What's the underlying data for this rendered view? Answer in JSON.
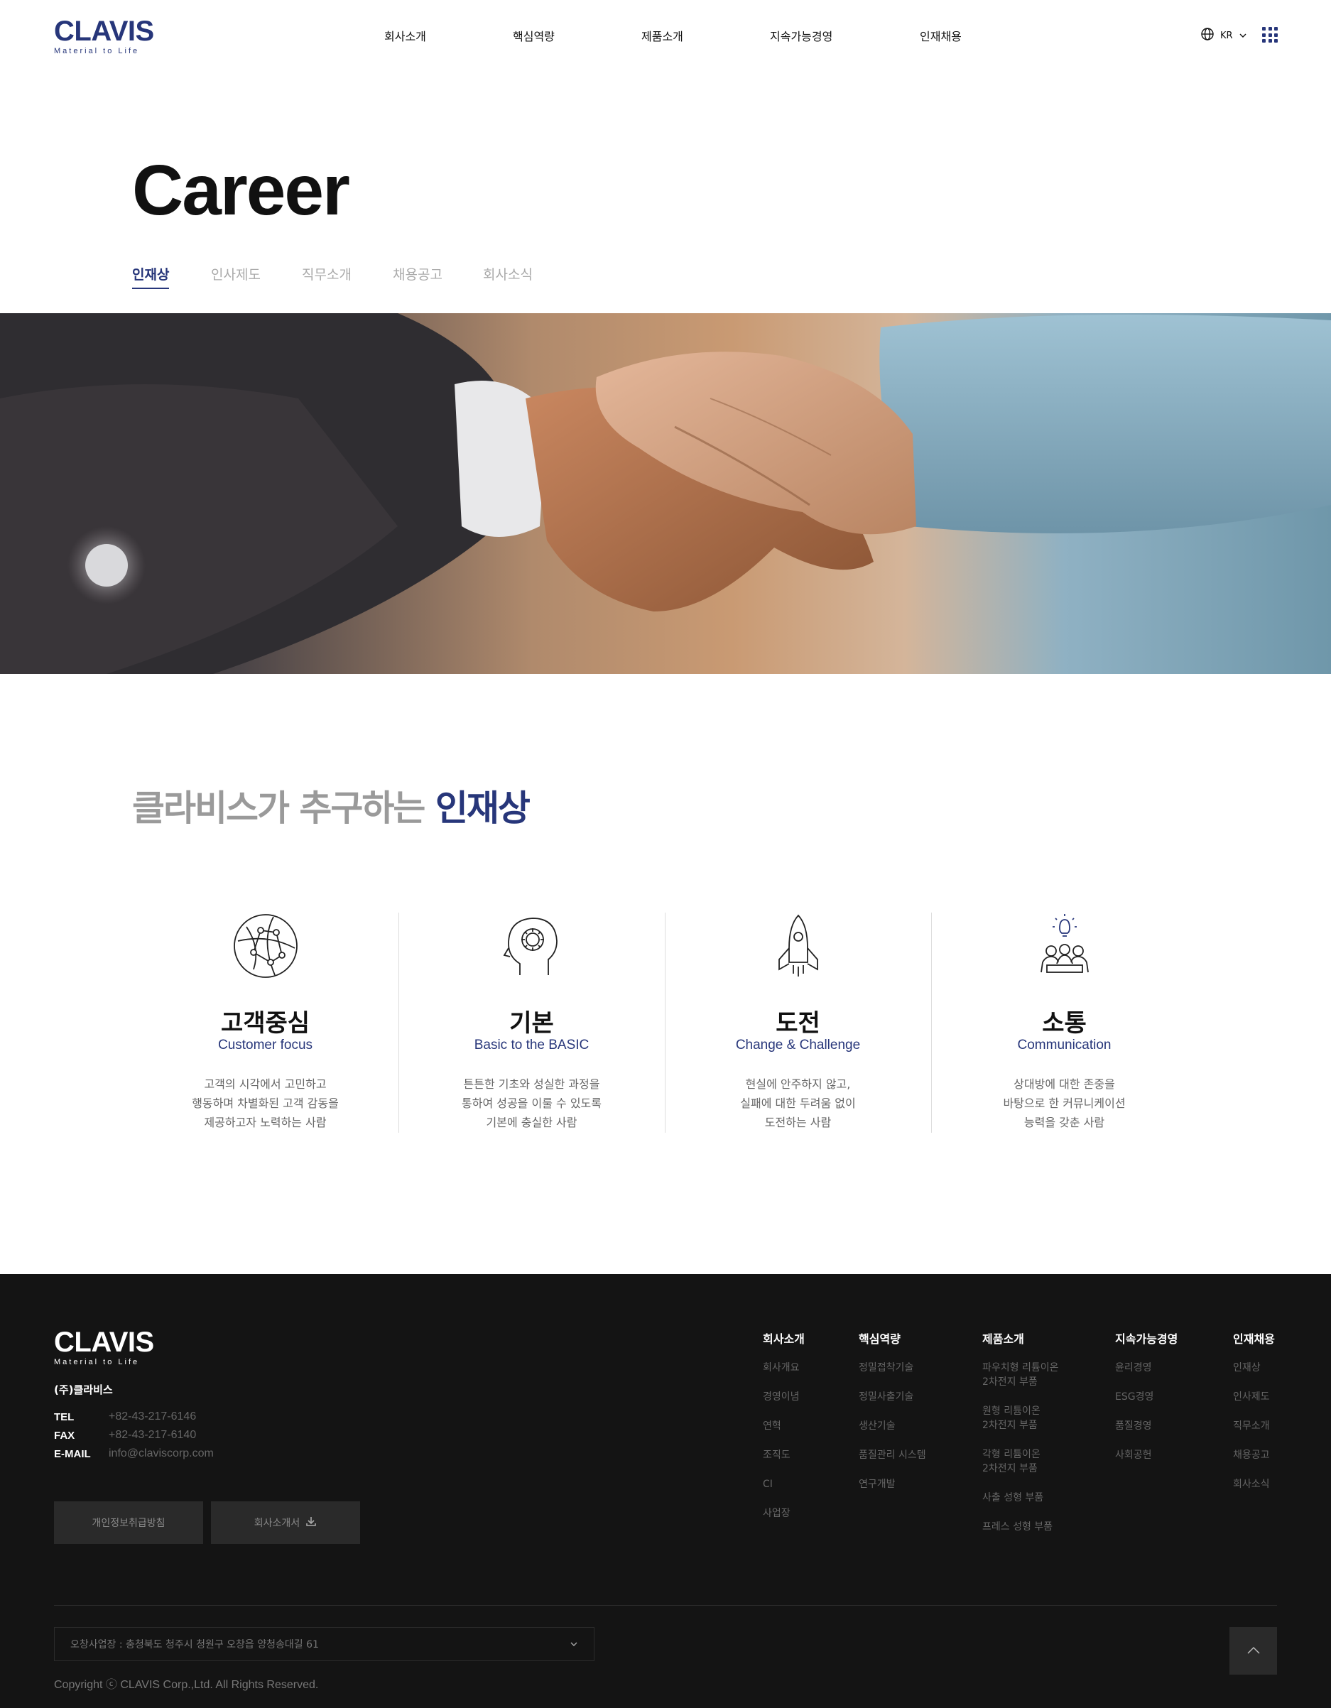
{
  "brand": {
    "name": "CLAVIS",
    "tagline": "Material to Life"
  },
  "gnb": {
    "items": [
      {
        "label": "회사소개"
      },
      {
        "label": "핵심역량"
      },
      {
        "label": "제품소개"
      },
      {
        "label": "지속가능경영"
      },
      {
        "label": "인재채용"
      }
    ]
  },
  "lang": {
    "label": "KR",
    "icon": "globe-icon"
  },
  "page": {
    "title": "Career",
    "subtabs": [
      {
        "label": "인재상",
        "active": true
      },
      {
        "label": "인사제도"
      },
      {
        "label": "직무소개"
      },
      {
        "label": "채용공고"
      },
      {
        "label": "회사소식"
      }
    ]
  },
  "hero": {
    "image": "handshake-photo"
  },
  "talent": {
    "title_prefix": "클라비스가 추구하는",
    "title_emphasis": "인재상",
    "values": [
      {
        "icon": "globe-network-icon",
        "title": "고객중심",
        "subtitle": "Customer focus",
        "desc": [
          "고객의 시각에서 고민하고",
          "행동하며 차별화된 고객 감동을",
          "제공하고자 노력하는 사람"
        ]
      },
      {
        "icon": "head-gear-icon",
        "title": "기본",
        "subtitle": "Basic to the BASIC",
        "desc": [
          "튼튼한 기초와 성실한 과정을",
          "통하여 성공을 이룰 수 있도록",
          "기본에 충실한 사람"
        ]
      },
      {
        "icon": "rocket-icon",
        "title": "도전",
        "subtitle": "Change & Challenge",
        "desc": [
          "현실에 안주하지 않고,",
          "실패에 대한 두려움 없이",
          "도전하는 사람"
        ]
      },
      {
        "icon": "team-idea-icon",
        "title": "소통",
        "subtitle": "Communication",
        "desc": [
          "상대방에 대한 존중을",
          "바탕으로 한 커뮤니케이션",
          "능력을 갖춘 사람"
        ]
      }
    ]
  },
  "footer": {
    "company": "(주)클라비스",
    "contacts": [
      {
        "key": "TEL",
        "value": "+82-43-217-6146"
      },
      {
        "key": "FAX",
        "value": "+82-43-217-6140"
      },
      {
        "key": "E-MAIL",
        "value": "info@claviscorp.com"
      }
    ],
    "buttons": {
      "privacy": "개인정보취급방침",
      "brochure": "회사소개서"
    },
    "nav": [
      {
        "head": "회사소개",
        "items": [
          "회사개요",
          "경영이념",
          "연혁",
          "조직도",
          "CI",
          "사업장"
        ]
      },
      {
        "head": "핵심역량",
        "items": [
          "정밀접착기술",
          "정밀사출기술",
          "생산기술",
          "품질관리 시스템",
          "연구개발"
        ]
      },
      {
        "head": "제품소개",
        "items": [
          "파우치형 리튬이온\n2차전지 부품",
          "원형 리튬이온\n2차전지 부품",
          "각형 리튬이온\n2차전지 부품",
          "사출 성형 부품",
          "프레스 성형 부품"
        ]
      },
      {
        "head": "지속가능경영",
        "items": [
          "윤리경영",
          "ESG경영",
          "품질경영",
          "사회공헌"
        ]
      },
      {
        "head": "인재채용",
        "items": [
          "인재상",
          "인사제도",
          "직무소개",
          "채용공고",
          "회사소식"
        ]
      }
    ],
    "site_select": "오창사업장 : 충청북도 청주시 청원구 오창읍 양청송대길 61",
    "copyright": "Copyright ⓒ CLAVIS Corp.,Ltd. All Rights Reserved."
  },
  "colors": {
    "brand": "#27367a",
    "footer_bg": "#141414",
    "muted": "#9a9a9a"
  }
}
